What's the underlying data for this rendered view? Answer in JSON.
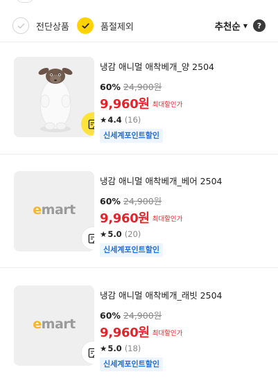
{
  "filters": {
    "items": [
      {
        "label": "전단상품",
        "checked": false
      },
      {
        "label": "품절제외",
        "checked": true
      }
    ],
    "sort_label": "추천순",
    "help_label": "?"
  },
  "products": [
    {
      "name": "냉감 애니멀 애착베개_양 2504",
      "discount": "60%",
      "original_price": "24,900원",
      "sale_price": "9,960원",
      "sale_tag": "최대할인가",
      "rating": "4.4",
      "reviews": "(16)",
      "promo": "신세계포인트할인",
      "image": "sheep-plush-pillow"
    },
    {
      "name": "냉감 애니멀 애착베개_베어 2504",
      "discount": "60%",
      "original_price": "24,900원",
      "sale_price": "9,960원",
      "sale_tag": "최대할인가",
      "rating": "5.0",
      "reviews": "(20)",
      "promo": "신세계포인트할인",
      "image": "emart-placeholder",
      "image_text": {
        "e": "e",
        "rest": "mart"
      }
    },
    {
      "name": "냉감 애니멀 애착베개_래빗 2504",
      "discount": "60%",
      "original_price": "24,900원",
      "sale_price": "9,960원",
      "sale_tag": "최대할인가",
      "rating": "5.0",
      "reviews": "(18)",
      "promo": "신세계포인트할인",
      "image": "emart-placeholder",
      "image_text": {
        "e": "e",
        "rest": "mart"
      }
    }
  ],
  "icons": {
    "star": "★",
    "caret": "▼",
    "check": "check-icon",
    "edit": "edit-note-icon"
  },
  "colors": {
    "accent_yellow": "#ffd200",
    "sale_red": "#e3242b",
    "promo_blue": "#1d6fe0",
    "promo_bg": "#eef5ff"
  }
}
